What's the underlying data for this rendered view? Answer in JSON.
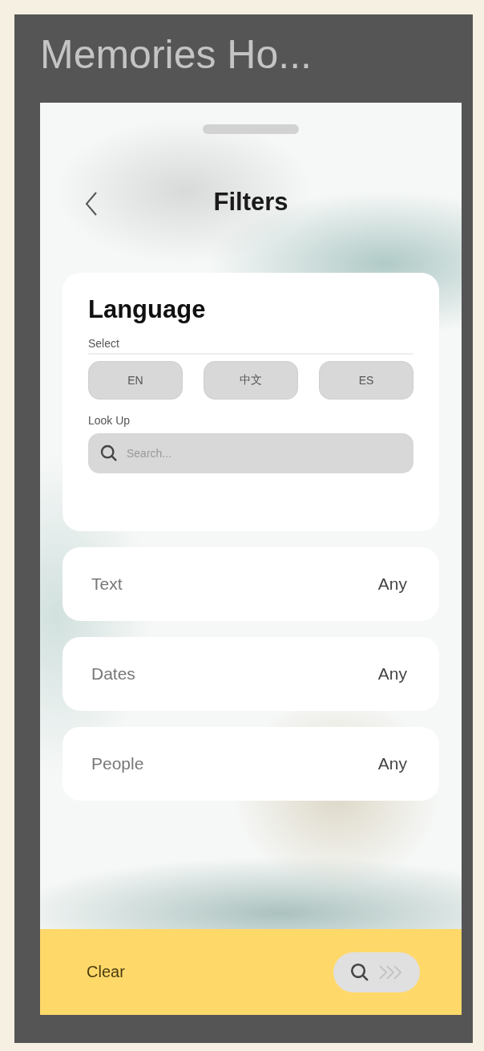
{
  "slide_title": "Memories Ho...",
  "header": {
    "title": "Filters"
  },
  "language": {
    "title": "Language",
    "select_label": "Select",
    "options": [
      {
        "label": "EN",
        "selected": false
      },
      {
        "label": "中文",
        "selected": false
      },
      {
        "label": "ES",
        "selected": false
      }
    ],
    "lookup_label": "Look Up",
    "search": {
      "placeholder": "Search..."
    }
  },
  "filters": [
    {
      "label": "Text",
      "value": "Any"
    },
    {
      "label": "Dates",
      "value": "Any"
    },
    {
      "label": "People",
      "value": "Any"
    }
  ],
  "footer": {
    "clear": "Clear"
  }
}
